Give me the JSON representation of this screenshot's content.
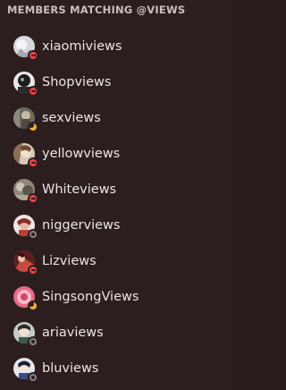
{
  "header": {
    "title": "MEMBERS MATCHING @VIEWS"
  },
  "colors": {
    "background": "#2c1e1e",
    "dnd": "#ed4245",
    "idle": "#f0b232",
    "offline": "#80848e"
  },
  "members": [
    {
      "name": "xiaomiviews",
      "status": "dnd",
      "avatar": "avatar-xiaomiviews"
    },
    {
      "name": "Shopviews",
      "status": "dnd",
      "avatar": "avatar-shopviews"
    },
    {
      "name": "sexviews",
      "status": "idle",
      "avatar": "avatar-sexviews"
    },
    {
      "name": "yellowviews",
      "status": "dnd",
      "avatar": "avatar-yellowviews"
    },
    {
      "name": "Whiteviews",
      "status": "dnd",
      "avatar": "avatar-whiteviews"
    },
    {
      "name": "niggerviews",
      "status": "offline",
      "avatar": "avatar-niggerviews"
    },
    {
      "name": "Lizviews",
      "status": "dnd",
      "avatar": "avatar-lizviews"
    },
    {
      "name": "SingsongViews",
      "status": "idle",
      "avatar": "avatar-singsongviews"
    },
    {
      "name": "ariaviews",
      "status": "offline",
      "avatar": "avatar-ariaviews"
    },
    {
      "name": "bluviews",
      "status": "offline",
      "avatar": "avatar-bluviews"
    }
  ]
}
